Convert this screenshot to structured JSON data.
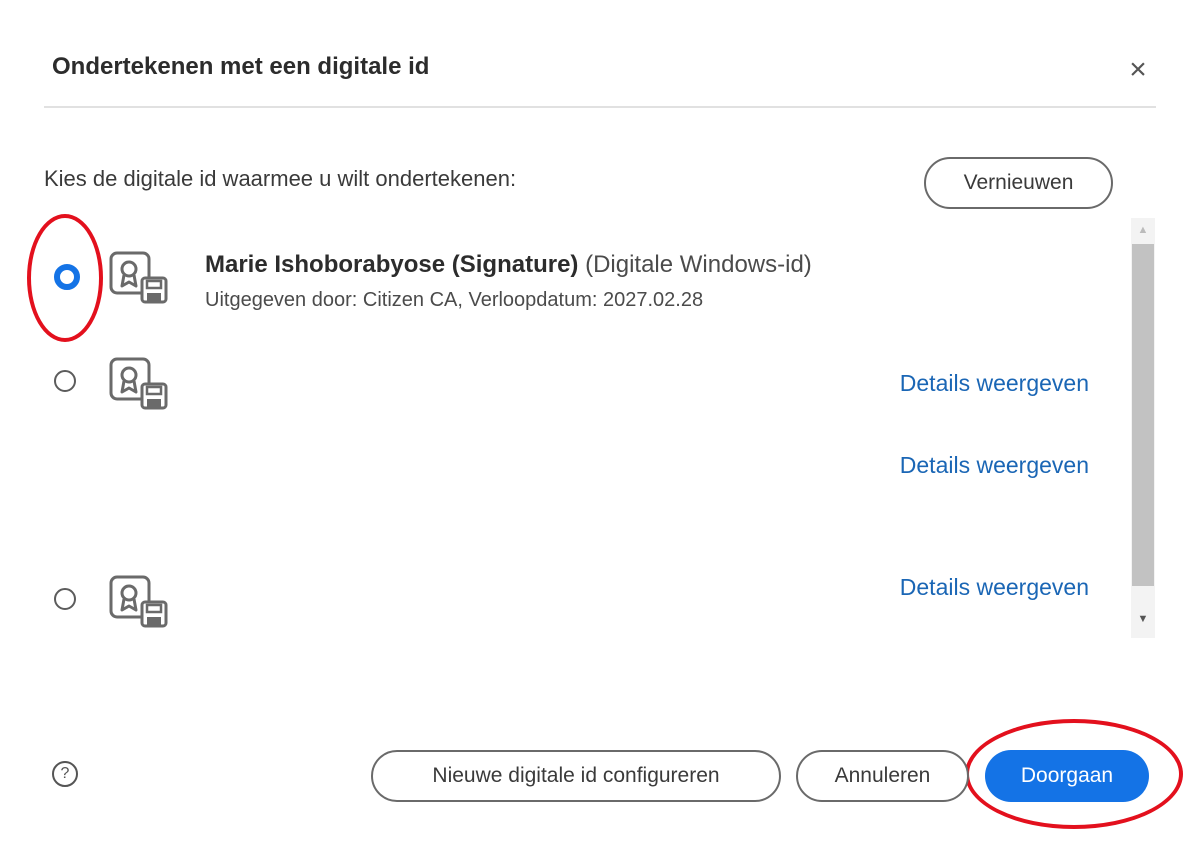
{
  "dialog": {
    "title": "Ondertekenen met een digitale id",
    "close_icon": "close-icon",
    "prompt": "Kies de digitale id waarmee u wilt ondertekenen:",
    "refresh_label": "Vernieuwen"
  },
  "ids": [
    {
      "selected": true,
      "name": "Marie Ishoborabyose (Signature)",
      "type": "(Digitale Windows-id)",
      "issuer": "Uitgegeven door: Citizen CA, Verloopdatum: 2027.02.28",
      "icon": "certificate-icon"
    },
    {
      "selected": false,
      "details_label": "Details weergeven",
      "icon": "certificate-icon"
    },
    {
      "details_label": "Details weergeven"
    },
    {
      "selected": false,
      "details_label": "Details weergeven",
      "icon": "certificate-icon"
    }
  ],
  "footer": {
    "help_icon": "help-icon",
    "help_glyph": "?",
    "new_id_label": "Nieuwe digitale id configureren",
    "cancel_label": "Annuleren",
    "continue_label": "Doorgaan"
  },
  "colors": {
    "accent": "#1473e6",
    "link": "#1a66b5",
    "annotation": "#e3101d"
  }
}
